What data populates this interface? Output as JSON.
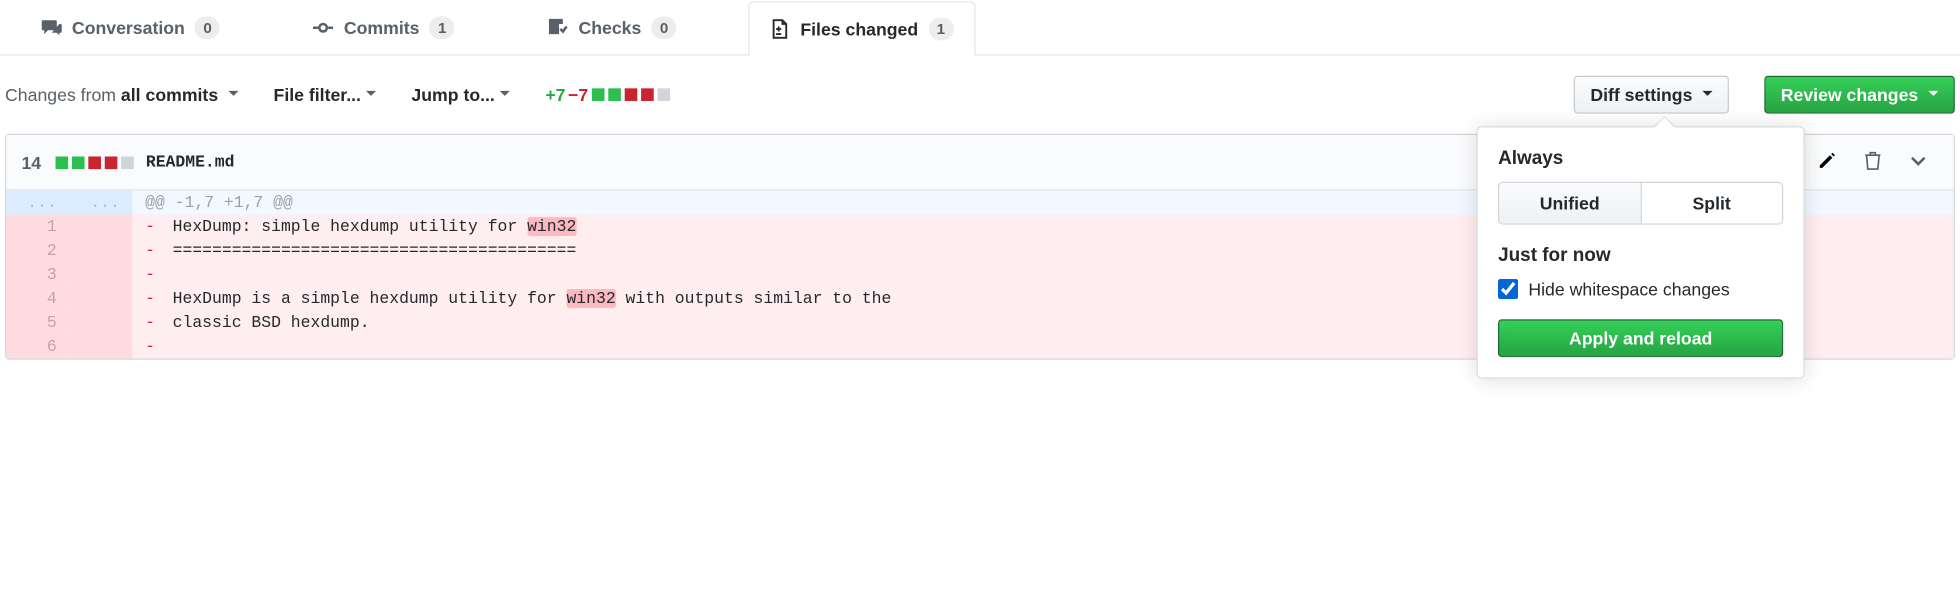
{
  "tabs": {
    "conversation": {
      "label": "Conversation",
      "count": "0"
    },
    "commits": {
      "label": "Commits",
      "count": "1"
    },
    "checks": {
      "label": "Checks",
      "count": "0"
    },
    "files": {
      "label": "Files changed",
      "count": "1"
    }
  },
  "toolbar": {
    "changes_from_prefix": "Changes from ",
    "changes_from_value": "all commits",
    "file_filter": "File filter...",
    "jump_to": "Jump to...",
    "additions": "+7",
    "deletions": "−7",
    "diff_settings": "Diff settings",
    "review_changes": "Review changes"
  },
  "file": {
    "stat": "14",
    "name": "README.md"
  },
  "diff": {
    "hunk": "@@ -1,7 +1,7 @@",
    "lines": [
      {
        "n": "1",
        "text": "HexDump: simple hexdump utility for ",
        "hl": "win32"
      },
      {
        "n": "2",
        "text": "========================================="
      },
      {
        "n": "3",
        "text": ""
      },
      {
        "n": "4",
        "text": "HexDump is a simple hexdump utility for ",
        "hl": "win32",
        "tail": " with outputs similar to the"
      },
      {
        "n": "5",
        "text": "classic BSD hexdump."
      },
      {
        "n": "6",
        "text": ""
      }
    ]
  },
  "popover": {
    "heading_always": "Always",
    "unified": "Unified",
    "split": "Split",
    "heading_now": "Just for now",
    "hide_ws": "Hide whitespace changes",
    "apply": "Apply and reload"
  }
}
